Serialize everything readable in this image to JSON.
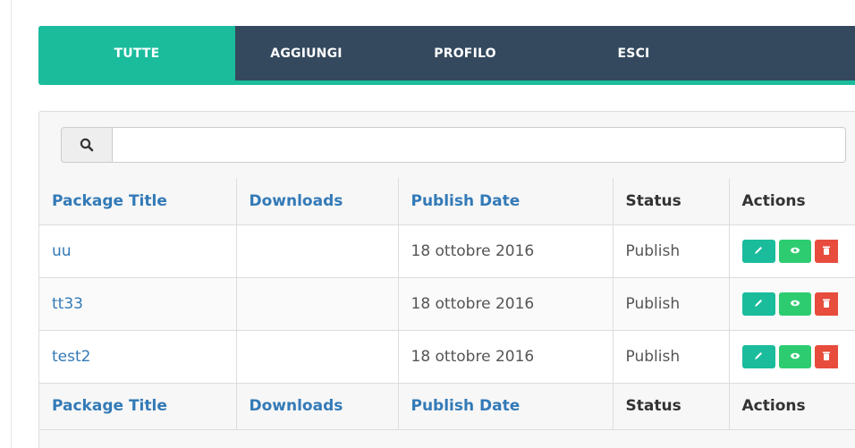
{
  "nav": {
    "tabs": [
      {
        "label": "TUTTE",
        "active": true
      },
      {
        "label": "AGGIUNGI",
        "active": false
      },
      {
        "label": "PROFILO",
        "active": false
      },
      {
        "label": "ESCI",
        "active": false
      }
    ]
  },
  "search": {
    "value": "",
    "placeholder": "",
    "icon": "search-icon"
  },
  "table": {
    "columns": [
      "Package Title",
      "Downloads",
      "Publish Date",
      "Status",
      "Actions"
    ],
    "rows": [
      {
        "title": "uu",
        "downloads": "",
        "date": "18 ottobre 2016",
        "status": "Publish"
      },
      {
        "title": "tt33",
        "downloads": "",
        "date": "18 ottobre 2016",
        "status": "Publish"
      },
      {
        "title": "test2",
        "downloads": "",
        "date": "18 ottobre 2016",
        "status": "Publish"
      }
    ],
    "action_icons": [
      "pencil-icon",
      "eye-icon",
      "trash-icon"
    ]
  },
  "colors": {
    "accent": "#1abc9c",
    "nav_bg": "#34495e",
    "link": "#337ab7",
    "edit": "#1abc9c",
    "view": "#2ecc71",
    "delete": "#e74c3c"
  }
}
